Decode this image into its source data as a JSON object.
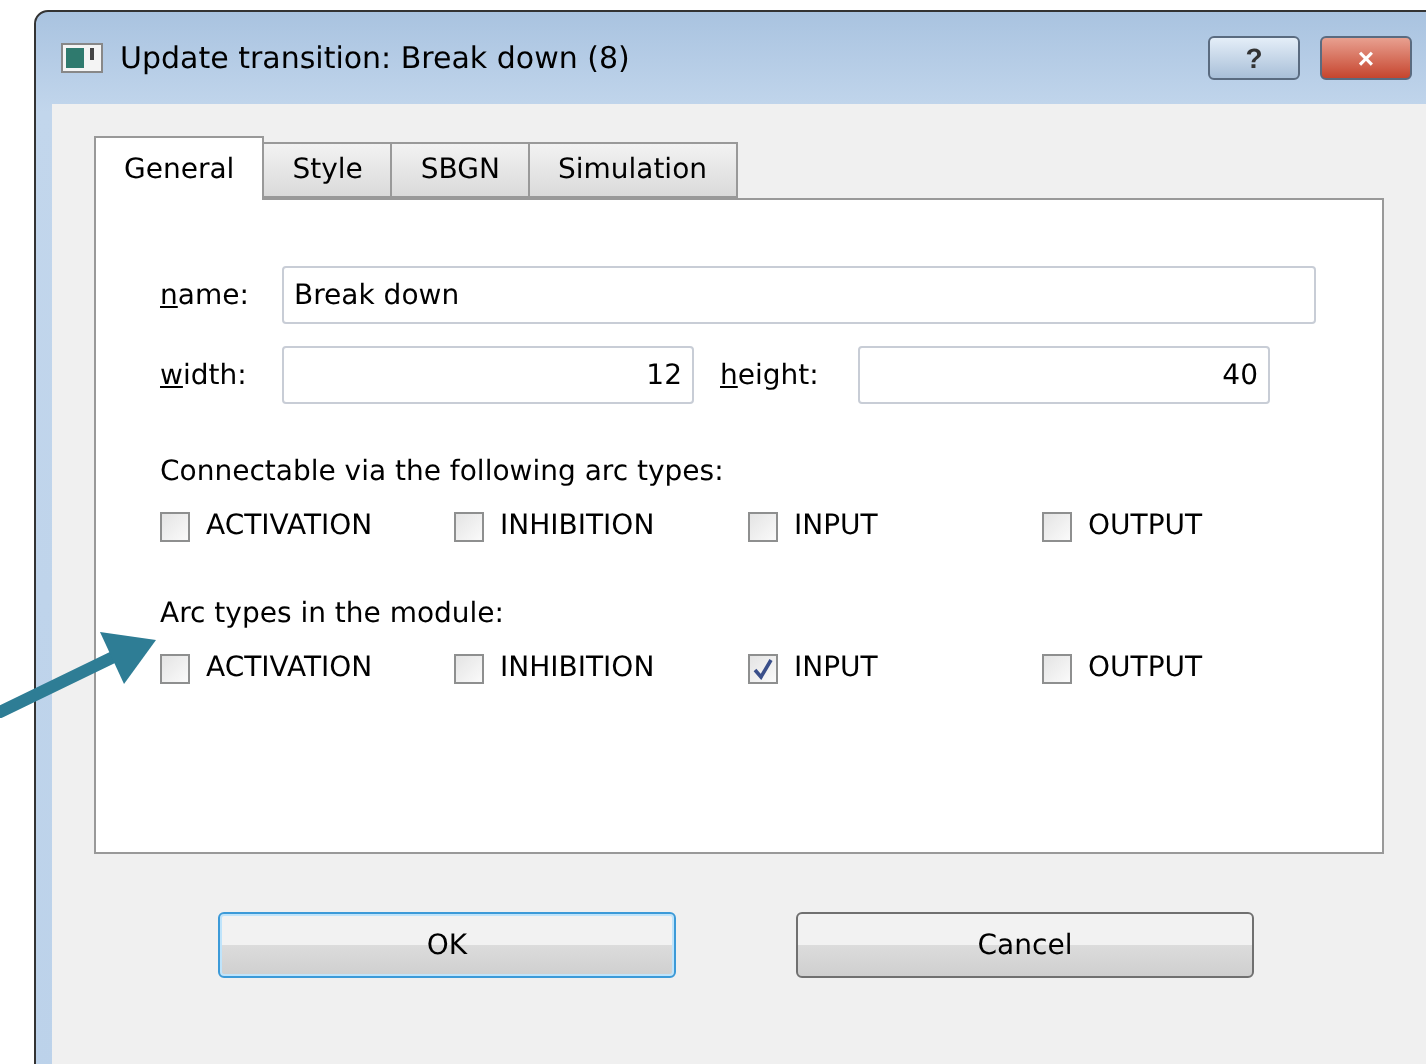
{
  "window": {
    "title": "Update transition: Break down (8)",
    "buttons": [
      {
        "kind": "help",
        "label": "?"
      },
      {
        "kind": "close",
        "label": "×"
      }
    ]
  },
  "tabs": [
    {
      "label": "General",
      "selected": true
    },
    {
      "label": "Style",
      "selected": false
    },
    {
      "label": "SBGN",
      "selected": false
    },
    {
      "label": "Simulation",
      "selected": false
    }
  ],
  "fields": [
    {
      "label": "name:",
      "value": "Break down"
    },
    {
      "label": "width:",
      "value": "12"
    },
    {
      "label": "height:",
      "value": "40"
    }
  ],
  "groups": [
    {
      "title": "Connectable via the following arc types:",
      "options": [
        {
          "label": "ACTIVATION",
          "checked": false
        },
        {
          "label": "INHIBITION",
          "checked": false
        },
        {
          "label": "INPUT",
          "checked": false
        },
        {
          "label": "OUTPUT",
          "checked": false
        }
      ]
    },
    {
      "title": "Arc types in the module:",
      "options": [
        {
          "label": "ACTIVATION",
          "checked": false
        },
        {
          "label": "INHIBITION",
          "checked": false
        },
        {
          "label": "INPUT",
          "checked": true
        },
        {
          "label": "OUTPUT",
          "checked": false
        }
      ]
    }
  ],
  "buttons": [
    {
      "label": "OK",
      "default": true
    },
    {
      "label": "Cancel",
      "default": false
    }
  ]
}
